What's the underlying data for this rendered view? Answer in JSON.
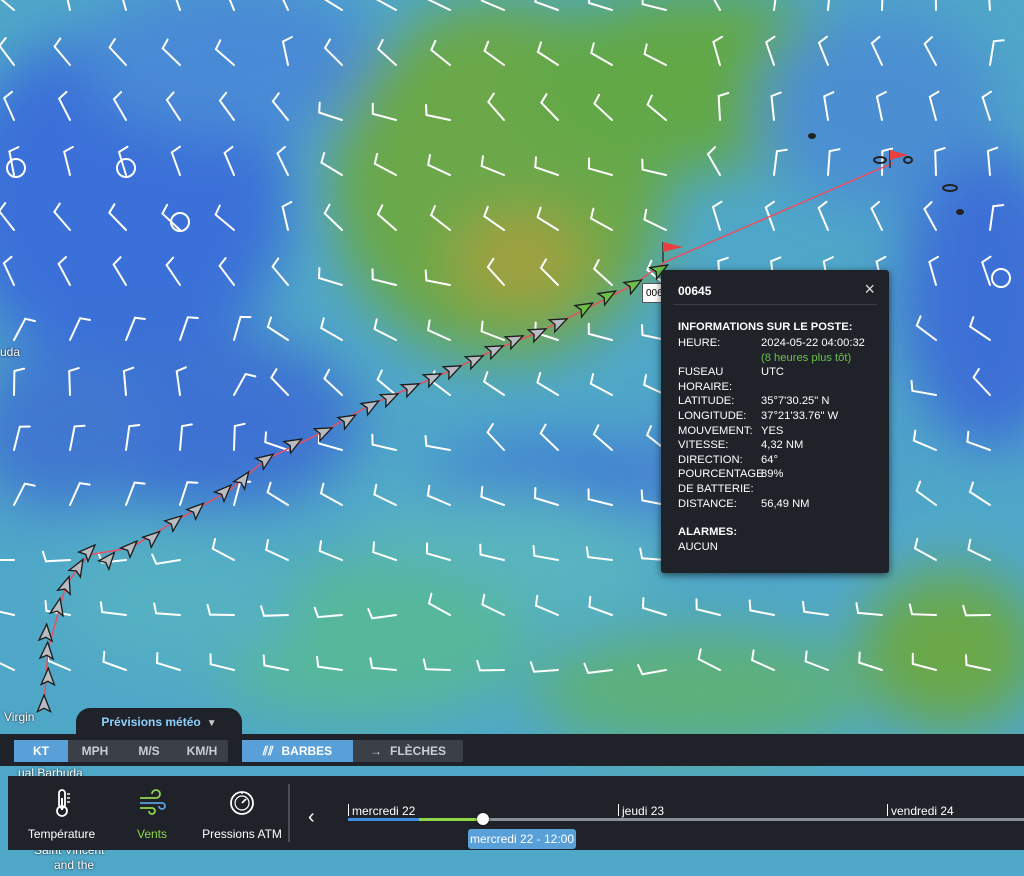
{
  "map": {
    "place_labels": [
      "uda",
      "Virgin",
      "ual Barbuda",
      "Saint Vincent",
      "and the"
    ]
  },
  "track": {
    "label_text": "006"
  },
  "popup": {
    "title": "00645",
    "close_glyph": "×",
    "section_title": "INFORMATIONS SUR LE POSTE:",
    "rows": [
      {
        "k": "HEURE:",
        "v": "2024-05-22 04:00:32",
        "sub": "(8 heures plus tôt)"
      },
      {
        "k": "FUSEAU HORAIRE:",
        "v": "UTC"
      },
      {
        "k": "LATITUDE:",
        "v": "35°7'30.25\" N"
      },
      {
        "k": "LONGITUDE:",
        "v": "37°21'33.76\" W"
      },
      {
        "k": "MOUVEMENT:",
        "v": "YES"
      },
      {
        "k": "VITESSE:",
        "v": "4,32 NM"
      },
      {
        "k": "DIRECTION:",
        "v": "64°"
      },
      {
        "k": "POURCENTAGE DE BATTERIE:",
        "v": "89%"
      },
      {
        "k": "DISTANCE:",
        "v": "56,49 NM"
      }
    ],
    "alarms_title": "ALARMES:",
    "alarms_value": "AUCUN"
  },
  "weather": {
    "tab_label": "Prévisions météo",
    "units": [
      "KT",
      "MPH",
      "M/S",
      "KM/H"
    ],
    "selected_unit": "KT",
    "display_modes": [
      "BARBES",
      "FLÈCHES"
    ],
    "selected_mode": "BARBES",
    "layers": [
      {
        "label": "Température",
        "icon": "thermometer-icon"
      },
      {
        "label": "Vents",
        "icon": "wind-icon"
      },
      {
        "label": "Pressions ATM",
        "icon": "gauge-icon"
      }
    ],
    "selected_layer": "Vents",
    "timeline": {
      "days": [
        "mercredi 22",
        "jeudi 23",
        "vendredi 24"
      ],
      "current": "mercredi 22 - 12:00"
    }
  },
  "colors": {
    "sea_blue": "#3a72d8",
    "land_green": "#5fa844",
    "track_green": "#6cc04a",
    "accent": "#5aa0d8",
    "flag_red": "#e84040"
  }
}
